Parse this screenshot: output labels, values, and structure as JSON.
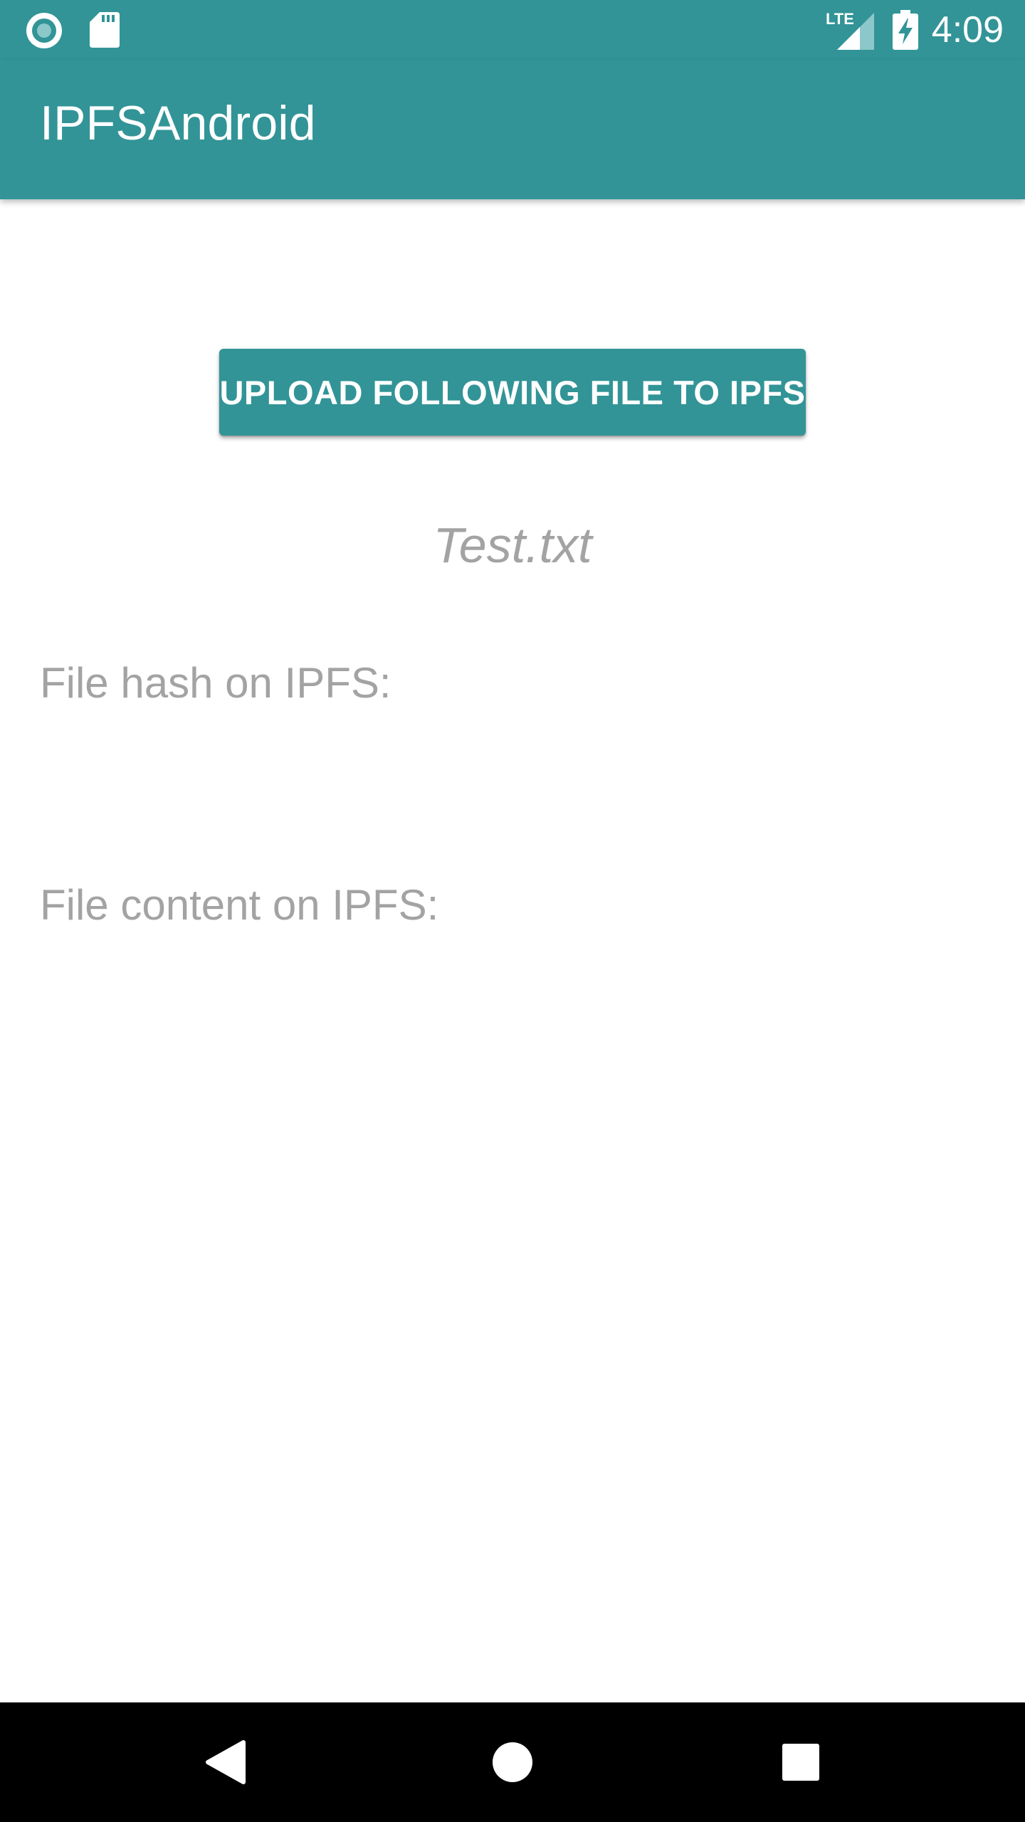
{
  "status_bar": {
    "time": "4:09",
    "network_type": "LTE",
    "icons": [
      "record-icon",
      "sd-card-icon",
      "lte-signal-icon",
      "battery-charging-icon"
    ]
  },
  "app_bar": {
    "title": "IPFSAndroid"
  },
  "main": {
    "upload_button_label": "UPLOAD FOLLOWING FILE TO IPFS",
    "file_name": "Test.txt",
    "hash_label": "File hash on IPFS:",
    "content_label": "File content on IPFS:"
  },
  "nav_bar": {
    "icons": [
      "back-icon",
      "home-icon",
      "recents-icon"
    ]
  },
  "colors": {
    "primary": "#329497",
    "secondary_text": "#a3a3a3",
    "nav_bar": "#000000"
  }
}
